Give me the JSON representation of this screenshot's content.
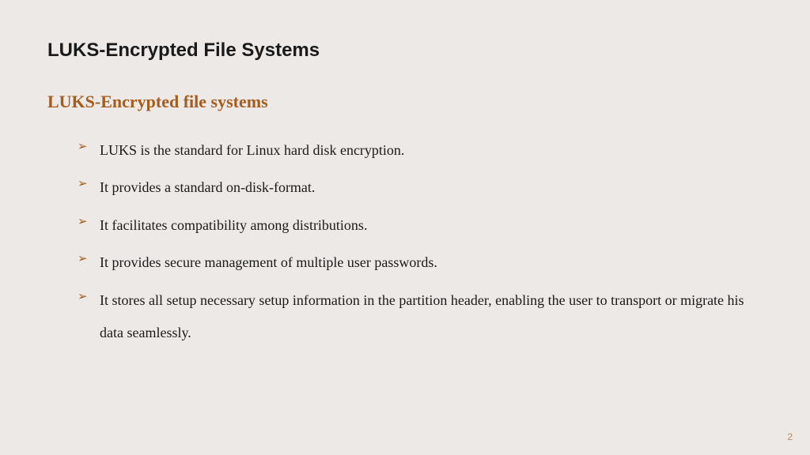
{
  "title": "LUKS-Encrypted File Systems",
  "subtitle": "LUKS-Encrypted file systems",
  "bullets": [
    "LUKS is the standard for Linux hard disk encryption.",
    "It provides a standard on-disk-format.",
    "It facilitates compatibility among distributions.",
    "It provides secure management of multiple user passwords.",
    "It stores all setup necessary setup information in the partition header, enabling the user to transport or migrate his data seamlessly."
  ],
  "bullet_glyph": "➢",
  "page_number": "2"
}
